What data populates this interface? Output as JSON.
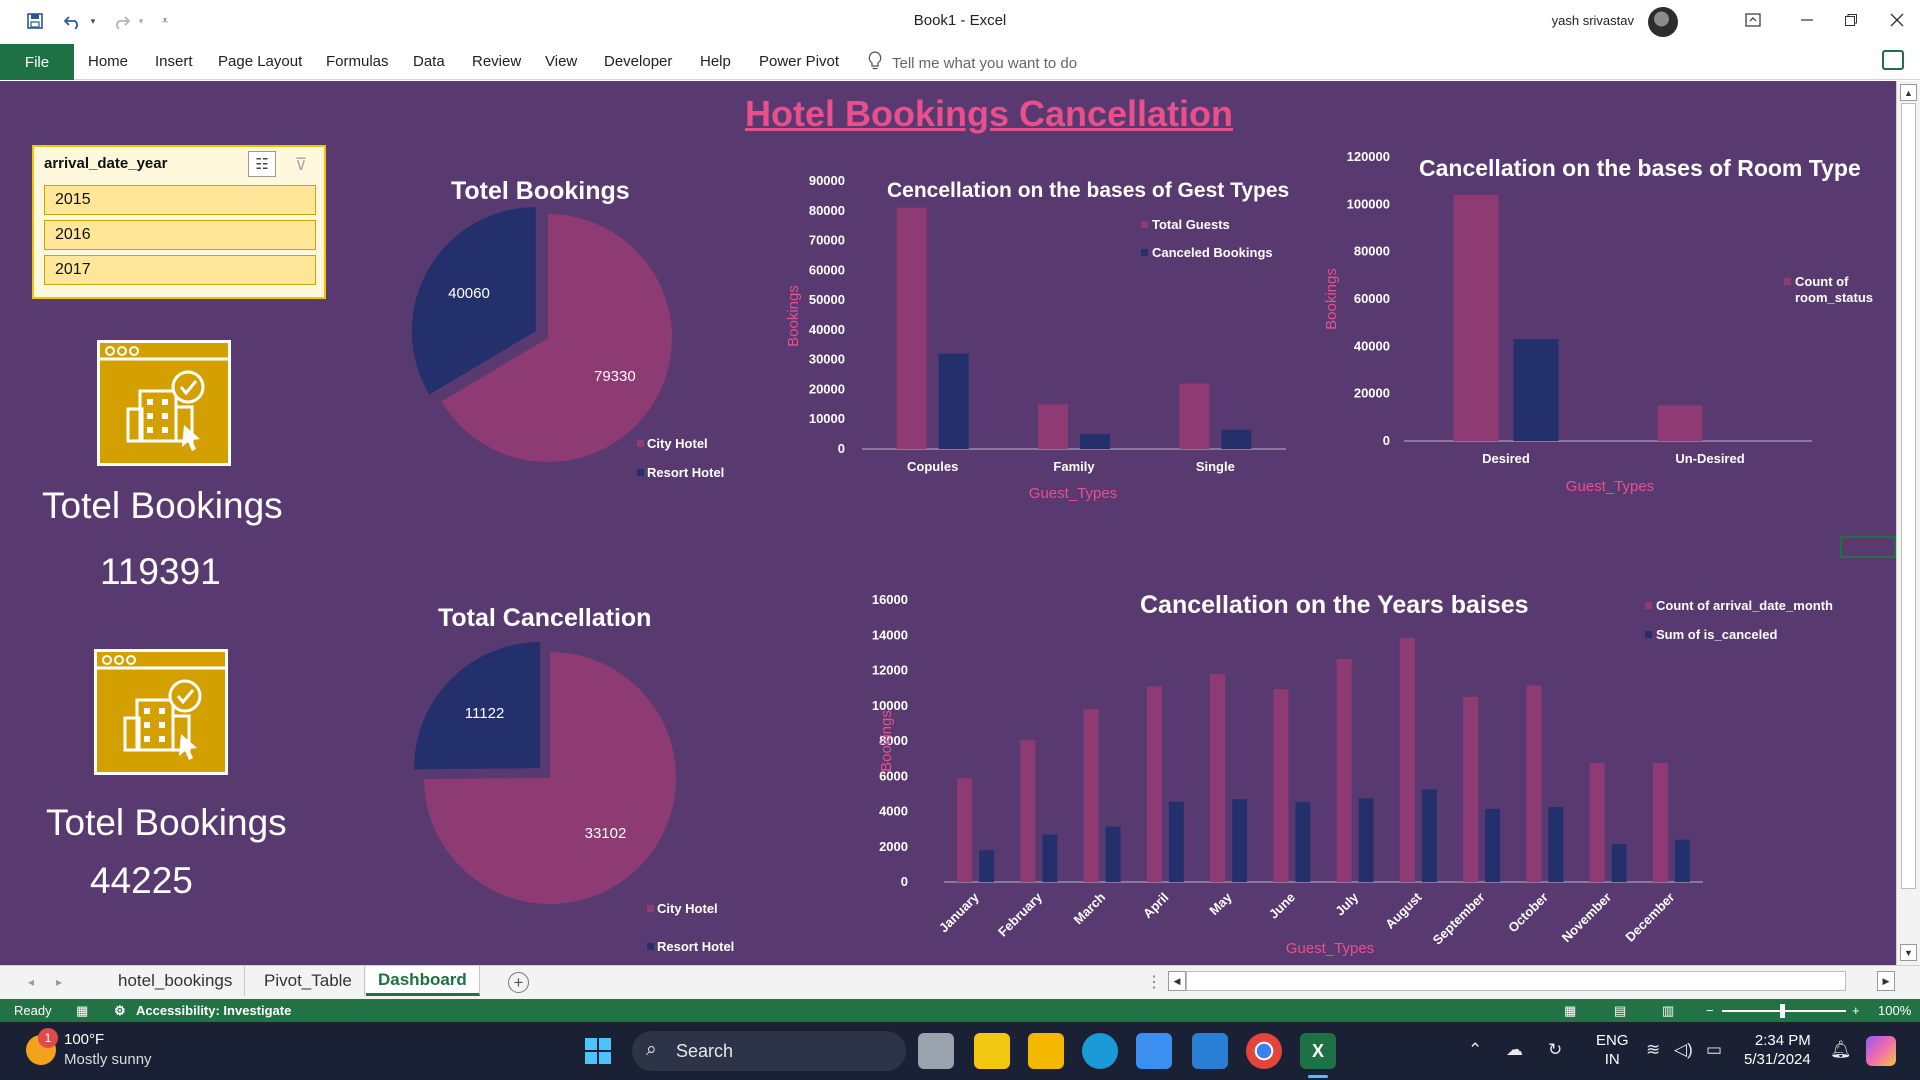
{
  "window": {
    "title": "Book1  -  Excel",
    "user_name": "yash srivastav"
  },
  "ribbon": {
    "file": "File",
    "tabs": [
      "Home",
      "Insert",
      "Page Layout",
      "Formulas",
      "Data",
      "Review",
      "View",
      "Developer",
      "Help",
      "Power Pivot"
    ],
    "tell_me": "Tell me what you want to do"
  },
  "dashboard": {
    "title": "Hotel Bookings Cancellation",
    "slicer": {
      "header": "arrival_date_year",
      "items": [
        "2015",
        "2016",
        "2017"
      ]
    },
    "kpi1": {
      "label": "Totel Bookings",
      "value": "119391"
    },
    "kpi2": {
      "label": "Totel Bookings",
      "value": "44225"
    }
  },
  "chart_data": [
    {
      "type": "pie",
      "title": "Totel Bookings",
      "labels": [
        "City Hotel",
        "Resort Hotel"
      ],
      "values": [
        79330,
        40060
      ],
      "colors": [
        "#8e3a73",
        "#24306c"
      ]
    },
    {
      "type": "bar",
      "title": "Cencellation on the bases of Gest Types",
      "categories": [
        "Copules",
        "Family",
        "Single"
      ],
      "series": [
        {
          "name": "Total Guests",
          "values": [
            81000,
            15000,
            22000
          ],
          "color": "#8e3a73"
        },
        {
          "name": "Canceled Bookings",
          "values": [
            32000,
            5000,
            6500
          ],
          "color": "#24306c"
        }
      ],
      "ylim": [
        0,
        90000
      ],
      "ticks": [
        "0",
        "10000",
        "20000",
        "30000",
        "40000",
        "50000",
        "60000",
        "70000",
        "80000",
        "90000"
      ],
      "xlabel": "Guest_Types",
      "ylabel": "Bookings",
      "legend": "top-right"
    },
    {
      "type": "bar",
      "title": "Cancellation on the bases of Room Type",
      "categories": [
        "Desired",
        "Un-Desired"
      ],
      "series": [
        {
          "name": "Count of room_status",
          "values": [
            104000,
            15000
          ],
          "color": "#8e3a73"
        },
        {
          "name": "",
          "values": [
            43000,
            0
          ],
          "color": "#24306c"
        }
      ],
      "ylim": [
        0,
        120000
      ],
      "ticks": [
        "0",
        "20000",
        "40000",
        "60000",
        "80000",
        "100000",
        "120000"
      ],
      "xlabel": "Guest_Types",
      "ylabel": "Bookings",
      "legend": "right"
    },
    {
      "type": "pie",
      "title": "Total Cancellation",
      "labels": [
        "City Hotel",
        "Resort Hotel"
      ],
      "values": [
        33102,
        11122
      ],
      "colors": [
        "#8e3a73",
        "#24306c"
      ]
    },
    {
      "type": "bar",
      "title": "Cancellation on the Years baises",
      "categories": [
        "January",
        "February",
        "March",
        "April",
        "May",
        "June",
        "July",
        "August",
        "September",
        "October",
        "November",
        "December"
      ],
      "series": [
        {
          "name": "Count of arrival_date_month",
          "values": [
            5900,
            8050,
            9800,
            11100,
            11800,
            10950,
            12650,
            13850,
            10500,
            11150,
            6750,
            6750
          ],
          "color": "#8e3a73"
        },
        {
          "name": "Sum of is_canceled",
          "values": [
            1800,
            2700,
            3150,
            4550,
            4700,
            4550,
            4750,
            5250,
            4150,
            4250,
            2150,
            2400
          ],
          "color": "#24306c"
        }
      ],
      "ylim": [
        0,
        16000
      ],
      "ticks": [
        "0",
        "2000",
        "4000",
        "6000",
        "8000",
        "10000",
        "12000",
        "14000",
        "16000"
      ],
      "xlabel": "Guest_Types",
      "ylabel": "Bookings",
      "legend": "top-right"
    }
  ],
  "sheet_tabs": [
    "hotel_bookings",
    "Pivot_Table",
    "Dashboard"
  ],
  "active_sheet": "Dashboard",
  "status": {
    "ready": "Ready",
    "accessibility": "Accessibility: Investigate",
    "zoom": "100%"
  },
  "taskbar": {
    "weather_badge": "1",
    "temperature": "100°F",
    "condition": "Mostly sunny",
    "search": "Search",
    "lang1": "ENG",
    "lang2": "IN",
    "time": "2:34 PM",
    "date": "5/31/2024"
  },
  "colors": {
    "sheet_bg": "#583a70",
    "accent_pink": "#8e3a73",
    "accent_navy": "#24306c",
    "title_pink": "#e84f8c",
    "excel_green": "#217346"
  }
}
